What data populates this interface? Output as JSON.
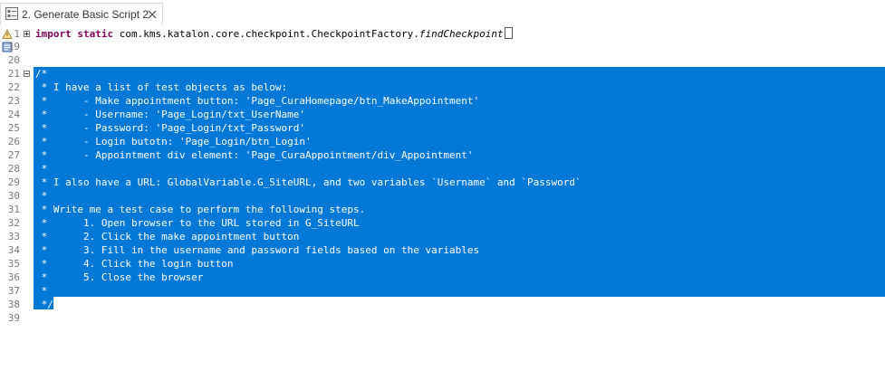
{
  "tab": {
    "label": "2. Generate Basic Script 2",
    "icon": "script-file-icon",
    "close_icon": "close-icon"
  },
  "editor": {
    "line_numbers": [
      "1",
      "19",
      "20",
      "21",
      "22",
      "23",
      "24",
      "25",
      "26",
      "27",
      "28",
      "29",
      "30",
      "31",
      "32",
      "33",
      "34",
      "35",
      "36",
      "37",
      "38",
      "39"
    ],
    "import_line": {
      "keyword_import": "import",
      "keyword_static": "static",
      "package": "com.kms.katalon.core.checkpoint.CheckpointFactory.",
      "method": "findCheckpoint"
    },
    "comment_lines": [
      "/*",
      " * I have a list of test objects as below:",
      " *      - Make appointment button: 'Page_CuraHomepage/btn_MakeAppointment'",
      " *      - Username: 'Page_Login/txt_UserName'",
      " *      - Password: 'Page_Login/txt_Password'",
      " *      - Login butotn: 'Page_Login/btn_Login'",
      " *      - Appointment div element: 'Page_CuraAppointment/div_Appointment'",
      " *",
      " * I also have a URL: GlobalVariable.G_SiteURL, and two variables `Username` and `Password`",
      " *",
      " * Write me a test case to perform the following steps.",
      " *      1. Open browser to the URL stored in G_SiteURL",
      " *      2. Click the make appointment button",
      " *      3. Fill in the username and password fields based on the variables",
      " *      4. Click the login button",
      " *      5. Close the browser",
      " *",
      " */"
    ]
  },
  "colors": {
    "selection": "#0078d7",
    "keyword": "#7f0055",
    "line_number": "#787878"
  }
}
